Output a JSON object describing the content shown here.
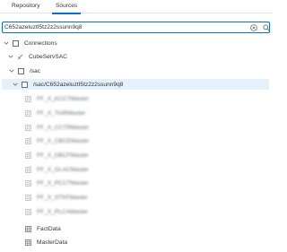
{
  "tabs": [
    {
      "label": "Repository"
    },
    {
      "label": "Sources"
    }
  ],
  "search": {
    "value": "C652azeluztI5tz2z2ssunn9q8"
  },
  "tree": {
    "connections": {
      "label": "Connections"
    },
    "cubeserv": {
      "label": "CubeServSAC"
    },
    "sac": {
      "label": "/sac"
    },
    "folder": {
      "label": "/sac/C652azeluztI5tz2z2ssunn9q8"
    },
    "blurred_items": [
      {
        "label": "FF_X_KCCTMaster"
      },
      {
        "label": "FF_X_TAIRMaster"
      },
      {
        "label": "FF_X_CCTRMaster"
      },
      {
        "label": "FF_X_CBCEMaster"
      },
      {
        "label": "FF_X_DBCFMaster"
      },
      {
        "label": "FF_X_GLACMaster"
      },
      {
        "label": "FF_X_PCCTMaster"
      },
      {
        "label": "FF_X_STKFMaster"
      },
      {
        "label": "FF_X_PLCAMaster"
      }
    ],
    "items": [
      {
        "label": "FactData"
      },
      {
        "label": "MasterData"
      }
    ]
  },
  "colors": {
    "accent": "#0a6ed1",
    "selected_row": "#e5f0fa",
    "text": "#32363a"
  }
}
